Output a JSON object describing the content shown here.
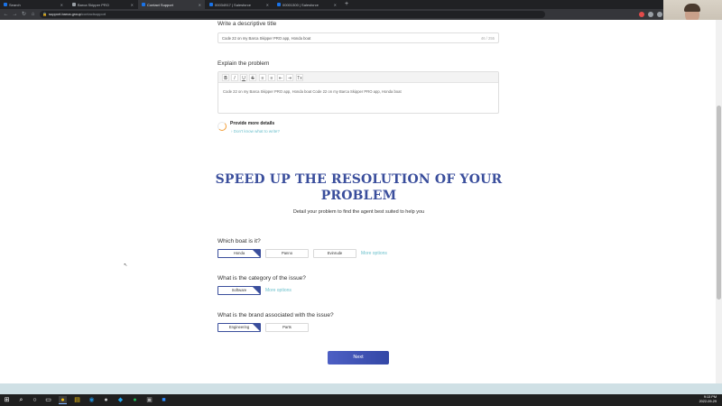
{
  "browser": {
    "tabs": [
      {
        "label": "Search",
        "active": false
      },
      {
        "label": "Barca Skipper PRO",
        "active": false
      },
      {
        "label": "Contact Support",
        "active": true
      },
      {
        "label": "00034917 | Salesforce",
        "active": false
      },
      {
        "label": "00001300 | Salesforce",
        "active": false
      }
    ],
    "url_domain": "support.barca.group",
    "url_path": "/contactsupport"
  },
  "form": {
    "title_label": "Write a descriptive title",
    "title_value": "Code 22 on my Barca Skipper PRO app, Honda boat",
    "title_count": "46 / 255",
    "problem_label": "Explain the problem",
    "editor_buttons": [
      "B",
      "I",
      "U",
      "S",
      "≡",
      "≡",
      "⇤",
      "⇥",
      "Tx"
    ],
    "problem_value": "Code 22 on my Barca Skipper PRO app, Honda boat Code 22 on my Barca Skipper PRO app, Honda boat",
    "details_title": "Provide more details",
    "details_link": "Don't know what to write?"
  },
  "speedup": {
    "title": "SPEED UP THE RESOLUTION OF YOUR PROBLEM",
    "subtitle": "Detail your problem to find the agent best suited to help you"
  },
  "questions": {
    "boat": {
      "label": "Which boat is it?",
      "options": [
        "Honda",
        "Panno",
        "Evinrude"
      ],
      "selected": "Honda",
      "more": "More options"
    },
    "category": {
      "label": "What is the category of the issue?",
      "options": [
        "Software"
      ],
      "selected": "Software",
      "more": "More options"
    },
    "brand": {
      "label": "What is the brand associated with the issue?",
      "options": [
        "Engineering",
        "Parts"
      ],
      "selected": "Engineering"
    }
  },
  "next_label": "Next",
  "system": {
    "time": "9:13 PM",
    "date": "2022-09-29"
  },
  "colors": {
    "accent": "#3a4e9c",
    "link": "#6cc0cc",
    "spinner": "#f39c34"
  }
}
